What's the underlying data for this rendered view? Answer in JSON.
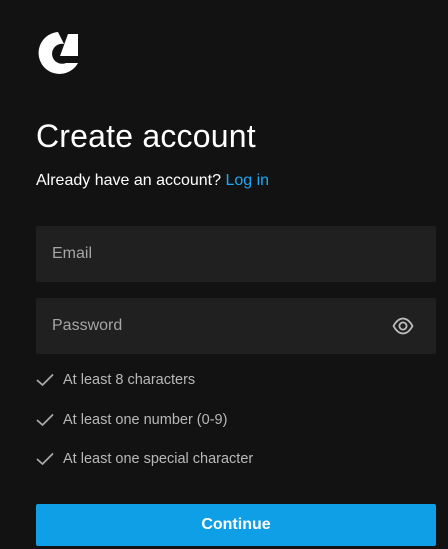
{
  "logo": {
    "icon": "brand-logo-icon"
  },
  "heading": {
    "title": "Create account"
  },
  "login_prompt": {
    "text": "Already have an account? ",
    "link_label": "Log in"
  },
  "form": {
    "email": {
      "value": "",
      "placeholder": "Email"
    },
    "password": {
      "value": "",
      "placeholder": "Password",
      "toggle_icon": "eye-icon"
    }
  },
  "requirements": [
    {
      "label": "At least 8 characters",
      "icon": "check-icon"
    },
    {
      "label": "At least one number (0-9)",
      "icon": "check-icon"
    },
    {
      "label": "At least one special character",
      "icon": "check-icon"
    }
  ],
  "actions": {
    "continue_label": "Continue"
  },
  "colors": {
    "background": "#121212",
    "field": "#202020",
    "accent": "#0f9fe6",
    "link": "#1ba9f5",
    "muted_text": "#b8b8b8"
  }
}
